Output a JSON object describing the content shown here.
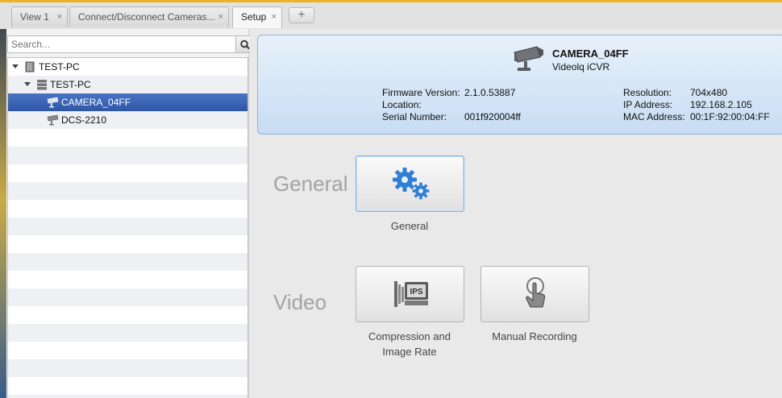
{
  "tabs": [
    {
      "label": "View 1",
      "close": "×"
    },
    {
      "label": "Connect/Disconnect Cameras...",
      "close": "×"
    },
    {
      "label": "Setup",
      "close": "×"
    }
  ],
  "add_tab": "+",
  "search": {
    "placeholder": "Search...",
    "value": ""
  },
  "tree": [
    {
      "label": "TEST-PC",
      "icon": "computer-icon"
    },
    {
      "label": "TEST-PC",
      "icon": "server-icon"
    },
    {
      "label": "CAMERA_04FF",
      "icon": "camera-icon",
      "selected": true
    },
    {
      "label": "DCS-2210",
      "icon": "camera-icon"
    }
  ],
  "camera": {
    "name": "CAMERA_04FF",
    "model": "Videolq iCVR",
    "fields_left": [
      {
        "label": "Firmware Version:",
        "value": "2.1.0.53887"
      },
      {
        "label": "Location:",
        "value": ""
      },
      {
        "label": "Serial Number:",
        "value": "001f920004ff"
      }
    ],
    "fields_right": [
      {
        "label": "Resolution:",
        "value": "704x480"
      },
      {
        "label": "IP Address:",
        "value": "192.168.2.105"
      },
      {
        "label": "MAC Address:",
        "value": "00:1F:92:00:04:FF"
      }
    ]
  },
  "sections": {
    "general": {
      "title": "General",
      "button_label": "General"
    },
    "video": {
      "title": "Video",
      "compression_line1": "Compression and",
      "compression_line2": "Image Rate",
      "ips_text": "IPS",
      "manual_label": "Manual Recording"
    }
  },
  "colors": {
    "accent": "#f0b12a",
    "selection": "#2f56a6",
    "panel": "#c8ddf3",
    "gear": "#2f7fd6"
  }
}
